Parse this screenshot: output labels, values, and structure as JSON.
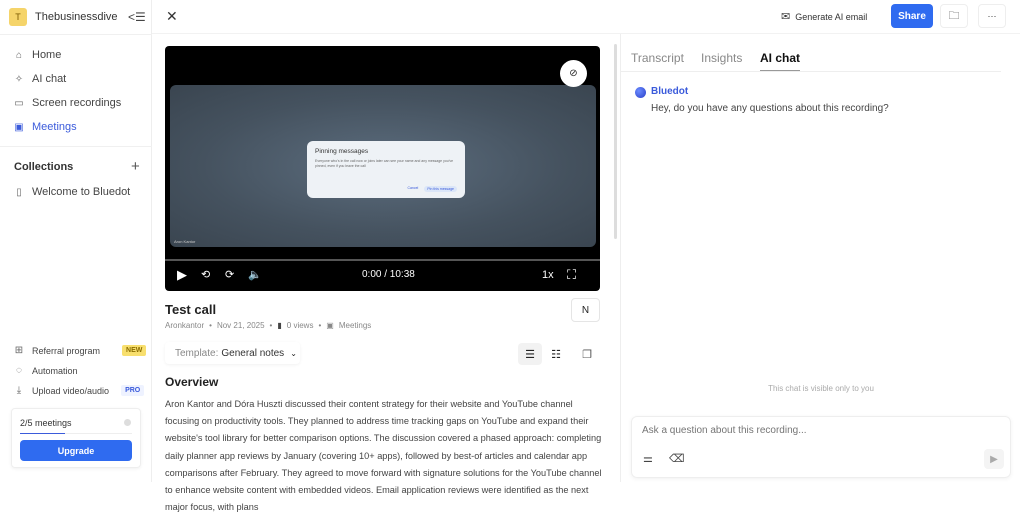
{
  "workspace": {
    "initial": "T",
    "name": "Thebusinessdive"
  },
  "nav": [
    {
      "label": "Home",
      "icon": "home-icon"
    },
    {
      "label": "AI chat",
      "icon": "sparkle-icon"
    },
    {
      "label": "Screen recordings",
      "icon": "camera-icon"
    },
    {
      "label": "Meetings",
      "icon": "meetings-icon"
    }
  ],
  "collections": {
    "title": "Collections",
    "items": [
      "Welcome to Bluedot"
    ]
  },
  "bottom_nav": [
    {
      "label": "Referral program",
      "badge": "NEW"
    },
    {
      "label": "Automation"
    },
    {
      "label": "Upload video/audio",
      "badge": "PRO"
    }
  ],
  "plan": {
    "usage": "2/5 meetings",
    "progress": 0.4,
    "upgrade": "Upgrade"
  },
  "topbar": {
    "generate_email": "Generate AI email",
    "share": "Share",
    "more": "···"
  },
  "video": {
    "dialog_title": "Pinning messages",
    "dialog_body": "Everyone who's in the call now or joins later can see your name and any message you've pinned, even if you leave the call",
    "cancel": "Cancel",
    "pin": "Pin this message",
    "speaker": "Aron Kantor",
    "time": "0:00 / 10:38",
    "speed": "1x"
  },
  "recording": {
    "title": "Test call",
    "author": "Aronkantor",
    "date": "Nov 21, 2025",
    "views": "0 views",
    "folder": "Meetings"
  },
  "template": {
    "label": "Template:",
    "value": "General notes"
  },
  "overview": {
    "heading": "Overview",
    "text": "Aron Kantor and Dóra Huszti discussed their content strategy for their website and YouTube channel focusing on productivity tools. They planned to address time tracking gaps on YouTube and expand their website's tool library for better comparison options. The discussion covered a phased approach: completing daily planner app reviews by January (covering 10+ apps), followed by best-of articles and calendar app comparisons after February. They agreed to move forward with signature solutions for the YouTube channel to enhance website content with embedded videos. Email application reviews were identified as the next major focus, with plans"
  },
  "tabs": [
    "Transcript",
    "Insights",
    "AI chat"
  ],
  "chat": {
    "sender": "Bluedot",
    "message": "Hey, do you have any questions about this recording?",
    "privacy": "This chat is visible only to you",
    "placeholder": "Ask a question about this recording..."
  },
  "colors": {
    "accent": "#2f6bf0",
    "active_nav": "#3b5bdb"
  }
}
